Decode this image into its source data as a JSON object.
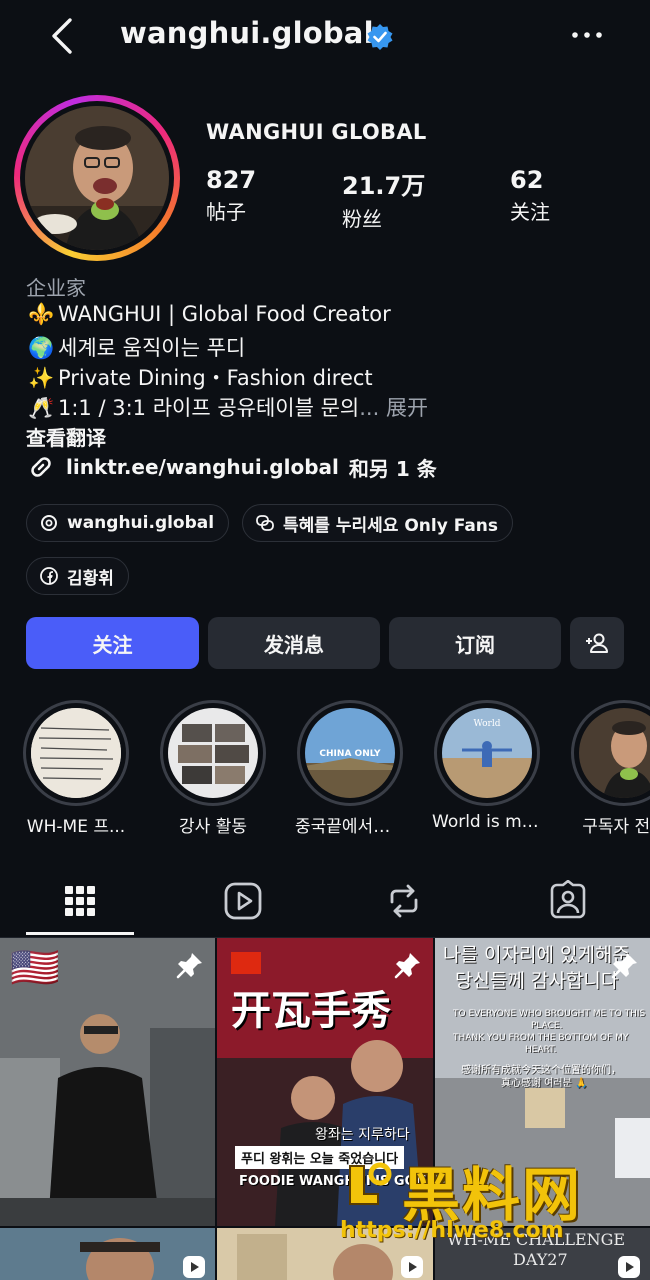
{
  "header": {
    "username": "wanghui.global"
  },
  "profile": {
    "display_name": "WANGHUI GLOBAL",
    "stats": [
      {
        "value": "827",
        "label": "帖子"
      },
      {
        "value": "21.7万",
        "label": "粉丝"
      },
      {
        "value": "62",
        "label": "关注"
      }
    ],
    "category": "企业家",
    "bio": [
      {
        "emoji": "⚜️",
        "text": "WANGHUI | Global Food Creator"
      },
      {
        "emoji": "🌍",
        "text": "세계로 움직이는 푸디"
      },
      {
        "emoji": "✨",
        "text": "Private Dining・Fashion direct"
      },
      {
        "emoji": "🥂",
        "text": "1:1 / 3:1 라이프 공유테이블 문의",
        "more": "... 展开"
      }
    ],
    "see_translation": "查看翻译",
    "link": "linktr.ee/wanghui.global",
    "link_suffix": "和另 1 条"
  },
  "pills": [
    {
      "label": "wanghui.global",
      "icon": "threads-icon"
    },
    {
      "label": "특혜를 누리세요 Only Fans",
      "icon": "chat-bubbles-icon"
    },
    {
      "label": "김황휘",
      "icon": "facebook-icon"
    }
  ],
  "actions": {
    "follow": "关注",
    "message": "发消息",
    "subscribe": "订阅",
    "add_user_icon": "add-person-icon"
  },
  "highlights": [
    {
      "label": "WH-ME 프..."
    },
    {
      "label": "강사 활동"
    },
    {
      "label": "중국끝에서도...",
      "cover_text": "CHINA ONLY"
    },
    {
      "label": "World is mi...",
      "cover_text": "World"
    },
    {
      "label": "구독자 전용"
    }
  ],
  "tabs": [
    "grid-icon",
    "reels-icon",
    "repost-icon",
    "tagged-icon"
  ],
  "posts": [
    {
      "flag": "🇺🇸",
      "pinned": true
    },
    {
      "pinned": true,
      "title": "开瓦手秀",
      "caption_ko": "왕좌는 지루하다",
      "caption_box": "푸디 왕휘는 오늘 죽었습니다",
      "caption_en": "FOODIE WANGHUI IS GONE"
    },
    {
      "pinned": true,
      "headline_1": "나를 이자리에 있게해준",
      "headline_2": "당신들께 감사합니다",
      "en_1": "TO EVERYONE WHO BROUGHT ME TO THIS",
      "en_2": "PLACE.",
      "en_3": "THANK YOU FROM THE BOTTOM OF MY",
      "en_4": "HEART.",
      "zh_1": "感谢所有成就今天这个位置的你们，",
      "zh_2": "真心感谢 여러분 🙏"
    },
    {
      "reel": true
    },
    {
      "reel": true
    },
    {
      "reel": true,
      "title": "WH-ME CHALLENGE",
      "day": "DAY27"
    }
  ],
  "watermark": {
    "title": "黑料网",
    "url": "https://hlwe8.com"
  },
  "colors": {
    "primary": "#4a5df9",
    "background": "#0c0f14",
    "verified": "#3797f0"
  }
}
